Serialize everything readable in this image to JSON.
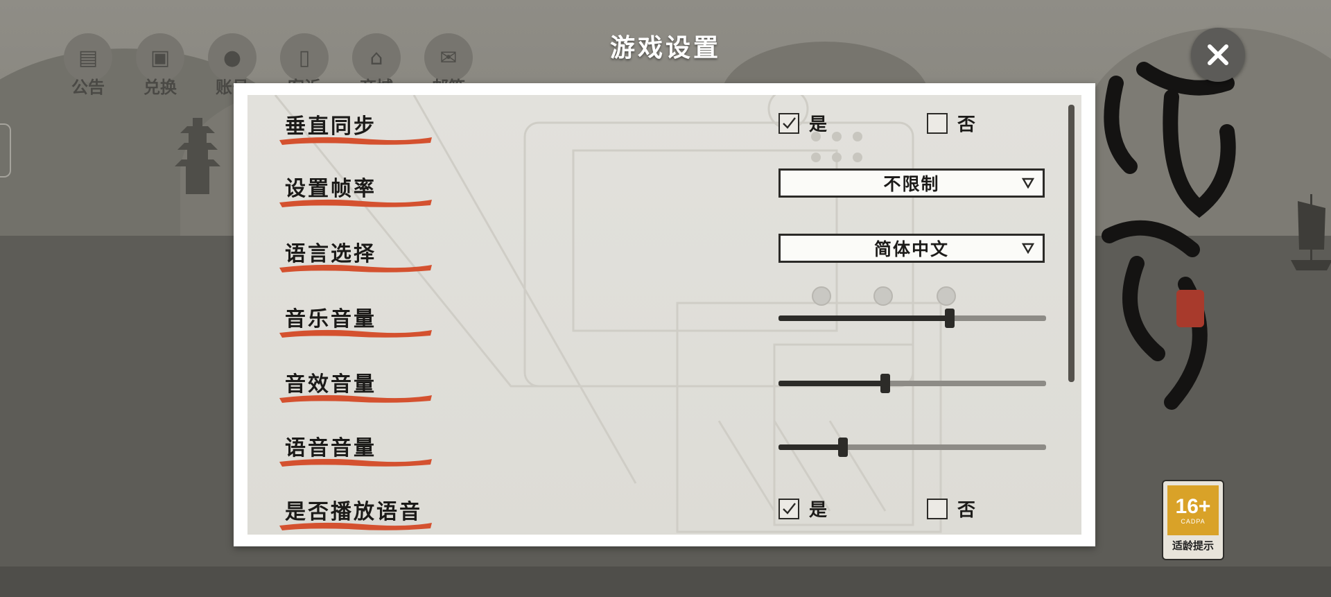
{
  "dialog": {
    "title": "游戏设置",
    "close_icon": "close-icon"
  },
  "background_nav": [
    {
      "label": "公告",
      "icon": "scroll-icon"
    },
    {
      "label": "兑换",
      "icon": "gift-icon"
    },
    {
      "label": "账号",
      "icon": "user-icon"
    },
    {
      "label": "客诉",
      "icon": "document-icon"
    },
    {
      "label": "商城",
      "icon": "shop-icon"
    },
    {
      "label": "邮箱",
      "icon": "mail-icon"
    }
  ],
  "settings": {
    "vsync": {
      "label": "垂直同步",
      "yes": "是",
      "no": "否",
      "selected": "yes"
    },
    "frame_rate": {
      "label": "设置帧率",
      "value": "不限制",
      "icon": "dropdown-triangle-icon"
    },
    "language": {
      "label": "语言选择",
      "value": "简体中文",
      "icon": "dropdown-triangle-icon"
    },
    "music_volume": {
      "label": "音乐音量",
      "level": 0.64
    },
    "sfx_volume": {
      "label": "音效音量",
      "level": 0.4
    },
    "voice_volume": {
      "label": "语音音量",
      "level": 0.24
    },
    "play_voice": {
      "label": "是否播放语音",
      "yes": "是",
      "no": "否",
      "selected": "yes"
    }
  },
  "age_rating": {
    "number": "16+",
    "org": "CADPA",
    "tip": "适龄提示"
  },
  "colors": {
    "accent_brush": "#d4512f",
    "panel_bg": "#e1e0db",
    "dim_overlay": "#5b5a55"
  }
}
